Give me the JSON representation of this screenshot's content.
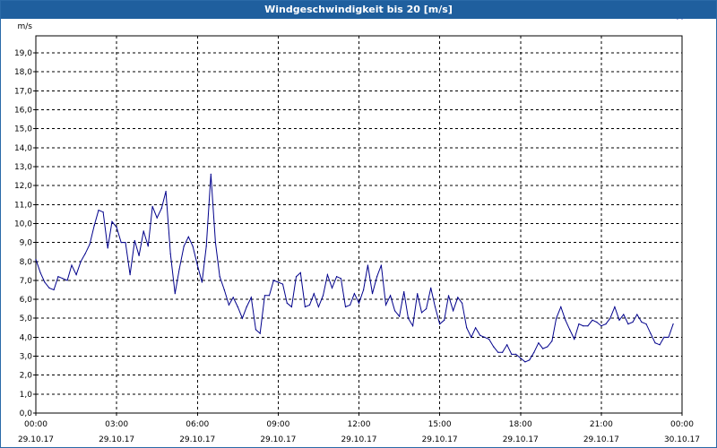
{
  "window": {
    "title": "Windgeschwindigkeit bis 20 [m/s]"
  },
  "chart_data": {
    "type": "line",
    "title": "Windgeschwindigkeit bis 20 [m/s]",
    "ylabel": "m/s",
    "xlabel": "",
    "ylim": [
      0,
      19.9
    ],
    "xlim_hours": [
      0,
      24
    ],
    "grid": true,
    "y_ticks": [
      "0,0",
      "1,0",
      "2,0",
      "3,0",
      "4,0",
      "5,0",
      "6,0",
      "7,0",
      "8,0",
      "9,0",
      "10,0",
      "11,0",
      "12,0",
      "13,0",
      "14,0",
      "15,0",
      "16,0",
      "17,0",
      "18,0",
      "19,0"
    ],
    "x_ticks": [
      {
        "time": "00:00",
        "date": "29.10.17"
      },
      {
        "time": "03:00",
        "date": "29.10.17"
      },
      {
        "time": "06:00",
        "date": "29.10.17"
      },
      {
        "time": "09:00",
        "date": "29.10.17"
      },
      {
        "time": "12:00",
        "date": "29.10.17"
      },
      {
        "time": "15:00",
        "date": "29.10.17"
      },
      {
        "time": "18:00",
        "date": "29.10.17"
      },
      {
        "time": "21:00",
        "date": "29.10.17"
      },
      {
        "time": "00:00",
        "date": "30.10.17"
      }
    ],
    "series": [
      {
        "color": "#00008b",
        "x_hours": [
          0.0,
          0.17,
          0.33,
          0.5,
          0.67,
          0.83,
          1.0,
          1.17,
          1.33,
          1.5,
          1.67,
          1.83,
          2.0,
          2.17,
          2.33,
          2.5,
          2.67,
          2.83,
          3.0,
          3.17,
          3.33,
          3.5,
          3.67,
          3.83,
          4.0,
          4.17,
          4.33,
          4.5,
          4.67,
          4.83,
          5.0,
          5.17,
          5.33,
          5.5,
          5.67,
          5.83,
          6.0,
          6.17,
          6.33,
          6.5,
          6.67,
          6.83,
          7.0,
          7.17,
          7.33,
          7.5,
          7.67,
          7.83,
          8.0,
          8.17,
          8.33,
          8.5,
          8.67,
          8.83,
          9.0,
          9.17,
          9.33,
          9.5,
          9.67,
          9.83,
          10.0,
          10.17,
          10.33,
          10.5,
          10.67,
          10.83,
          11.0,
          11.17,
          11.33,
          11.5,
          11.67,
          11.83,
          12.0,
          12.17,
          12.33,
          12.5,
          12.67,
          12.83,
          13.0,
          13.17,
          13.33,
          13.5,
          13.67,
          13.83,
          14.0,
          14.17,
          14.33,
          14.5,
          14.67,
          14.83,
          15.0,
          15.17,
          15.33,
          15.5,
          15.67,
          15.83,
          16.0,
          16.17,
          16.33,
          16.5,
          16.67,
          16.83,
          17.0,
          17.17,
          17.33,
          17.5,
          17.67,
          17.83,
          18.0,
          18.17,
          18.33,
          18.5,
          18.67,
          18.83,
          19.0,
          19.17,
          19.33,
          19.5,
          19.67,
          19.83,
          20.0,
          20.17,
          20.33,
          20.5,
          20.67,
          20.83,
          21.0,
          21.17,
          21.33,
          21.5,
          21.67,
          21.83,
          22.0,
          22.17,
          22.33,
          22.5,
          22.67,
          22.83,
          23.0,
          23.17,
          23.33,
          23.5,
          23.67,
          23.83,
          24.0
        ],
        "values": [
          8.1,
          7.4,
          6.9,
          6.6,
          6.5,
          7.2,
          7.1,
          7.0,
          7.8,
          7.3,
          8.0,
          8.4,
          8.9,
          9.9,
          10.7,
          10.6,
          8.7,
          10.1,
          9.8,
          9.0,
          9.0,
          7.3,
          9.1,
          8.3,
          9.6,
          8.8,
          10.9,
          10.3,
          10.8,
          11.7,
          8.4,
          6.3,
          7.6,
          8.8,
          9.3,
          8.8,
          7.8,
          6.9,
          8.8,
          12.6,
          9.0,
          7.2,
          6.5,
          5.7,
          6.1,
          5.6,
          5.0,
          5.6,
          6.1,
          4.4,
          4.2,
          6.2,
          6.2,
          7.0,
          6.9,
          6.8,
          5.8,
          5.6,
          7.2,
          7.4,
          5.6,
          5.7,
          6.3,
          5.6,
          6.2,
          7.3,
          6.6,
          7.2,
          7.1,
          5.6,
          5.7,
          6.3,
          5.8,
          6.5,
          7.8,
          6.3,
          7.2,
          7.8,
          5.7,
          6.2,
          5.4,
          5.1,
          6.4,
          5.0,
          4.6,
          6.3,
          5.3,
          5.5,
          6.6,
          5.6,
          4.7,
          4.9,
          6.2,
          5.4,
          6.1,
          5.8,
          4.5,
          4.0,
          4.5,
          4.1,
          4.0,
          3.9,
          3.5,
          3.2,
          3.2,
          3.6,
          3.1,
          3.1,
          2.9,
          2.7,
          2.8,
          3.2,
          3.7,
          3.4,
          3.5,
          3.8,
          5.0,
          5.6,
          4.9,
          4.4,
          3.9,
          4.7,
          4.6,
          4.6,
          4.9,
          4.8,
          4.6,
          4.7,
          5.0,
          5.6,
          4.9,
          5.2,
          4.7,
          4.8,
          5.2,
          4.8,
          4.7,
          4.2,
          3.7,
          3.6,
          4.0,
          4.0,
          4.7
        ]
      }
    ]
  }
}
